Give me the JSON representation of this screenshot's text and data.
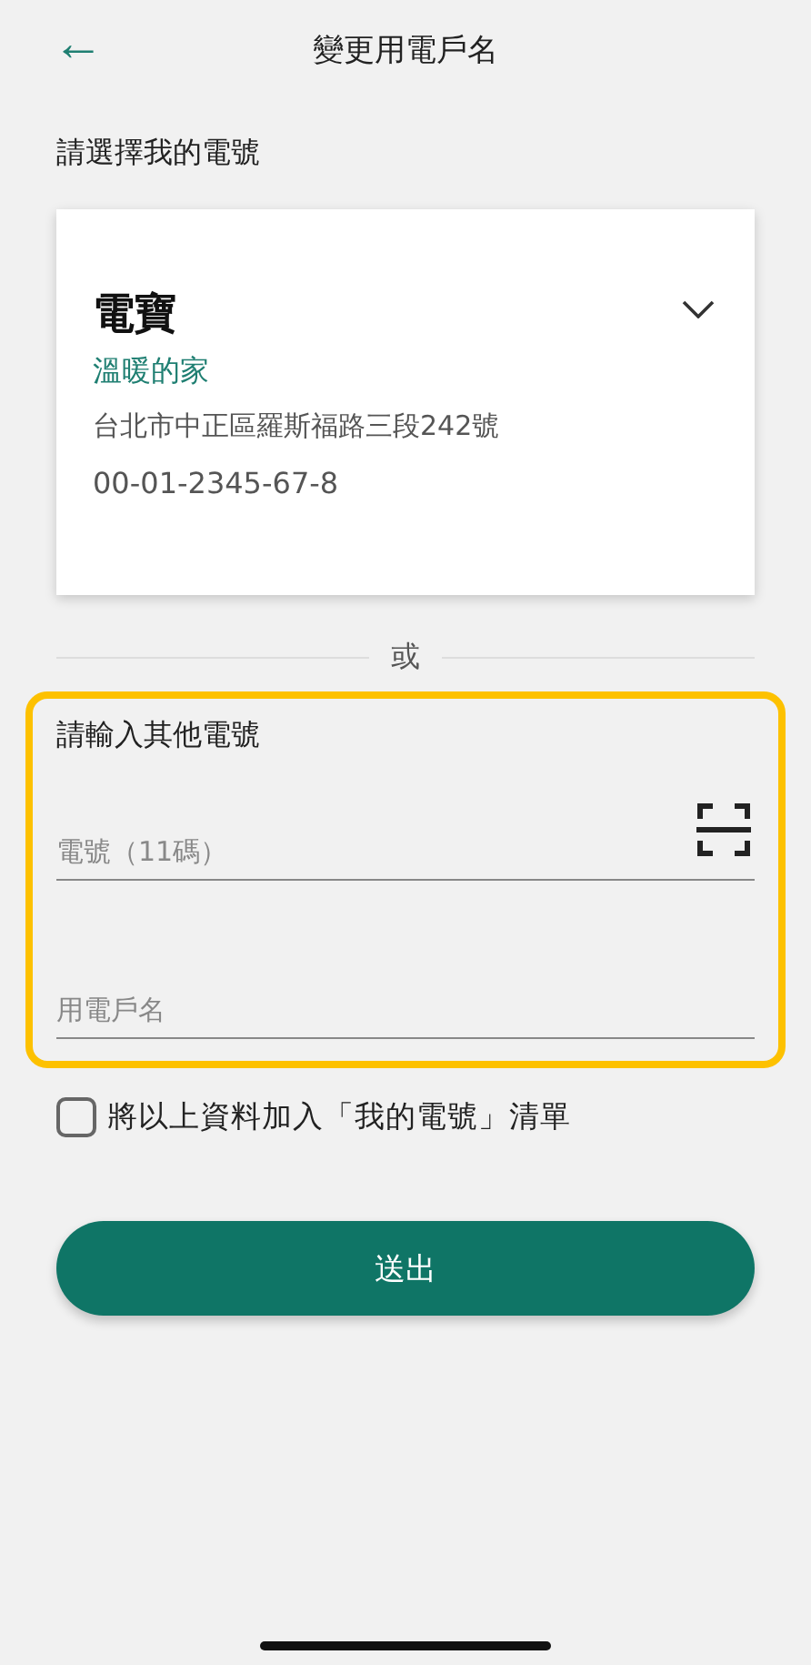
{
  "header": {
    "back": "←",
    "title": "變更用電戶名"
  },
  "my_numbers": {
    "label": "請選擇我的電號",
    "card": {
      "name": "電寶",
      "nickname": "溫暖的家",
      "address": "台北市中正區羅斯福路三段242號",
      "number": "00-01-2345-67-8"
    }
  },
  "divider": "或",
  "other": {
    "label": "請輸入其他電號",
    "fields": [
      {
        "placeholder": "電號（11碼）",
        "kind": "scan"
      },
      {
        "placeholder": "用電戶名",
        "kind": "plain"
      }
    ]
  },
  "save_to_list": {
    "label": "將以上資料加入「我的電號」清單",
    "checked": false
  },
  "submit": "送出"
}
